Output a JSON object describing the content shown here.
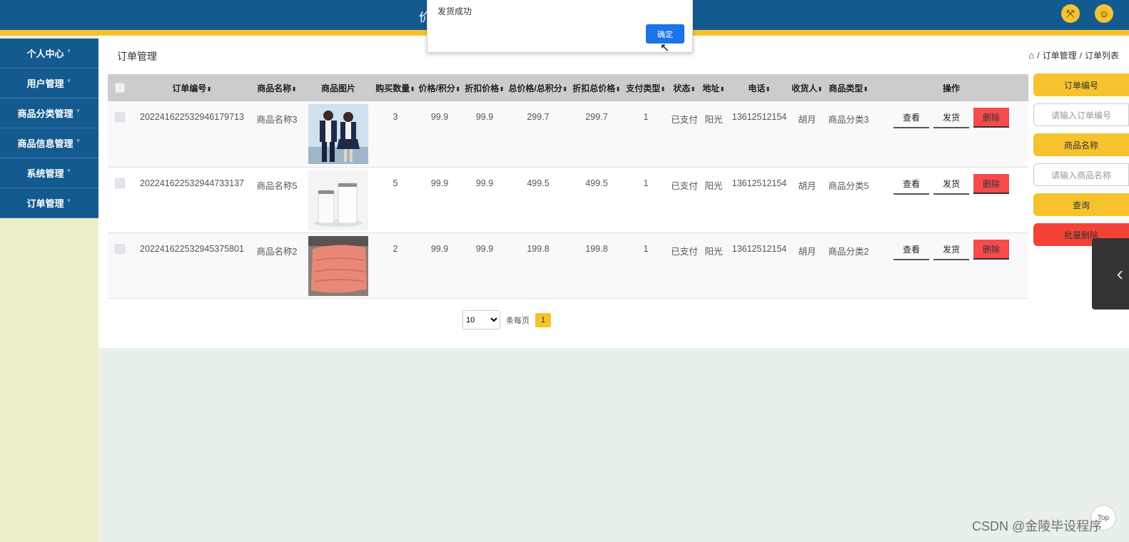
{
  "header": {
    "title_partial": "价",
    "expand_icon": "expand-arrows-icon",
    "user_icon": "user-icon"
  },
  "sidebar": {
    "items": [
      {
        "label": "个人中心"
      },
      {
        "label": "用户管理"
      },
      {
        "label": "商品分类管理"
      },
      {
        "label": "商品信息管理"
      },
      {
        "label": "系统管理"
      },
      {
        "label": "订单管理"
      }
    ]
  },
  "page": {
    "title": "订单管理",
    "breadcrumb": {
      "sep": "/",
      "level1": "订单管理",
      "level2": "订单列表"
    }
  },
  "table": {
    "headers": {
      "order_no": "订单编号",
      "product_name": "商品名称",
      "product_image": "商品图片",
      "qty": "购买数量",
      "price": "价格/积分",
      "discount_price": "折扣价格",
      "total": "总价格/总积分",
      "discount_total": "折扣总价格",
      "pay_type": "支付类型",
      "status": "状态",
      "address": "地址",
      "phone": "电话",
      "receiver": "收货人",
      "product_type": "商品类型",
      "ops": "操作"
    },
    "rows": [
      {
        "order_no": "20224162253294617971​3",
        "product_name": "商品名称3",
        "image": "school-uniform-photo",
        "qty": "3",
        "price": "99.9",
        "discount_price": "99.9",
        "total": "299.7",
        "discount_total": "299.7",
        "pay_type": "1",
        "status": "已支付",
        "address": "阳光",
        "phone": "13612512154",
        "receiver": "胡月",
        "product_type": "商品分类3"
      },
      {
        "order_no": "202241622532944733137",
        "product_name": "商品名称5",
        "image": "white-cups-photo",
        "qty": "5",
        "price": "99.9",
        "discount_price": "99.9",
        "total": "499.5",
        "discount_total": "499.5",
        "pay_type": "1",
        "status": "已支付",
        "address": "阳光",
        "phone": "13612512154",
        "receiver": "胡月",
        "product_type": "商品分类5"
      },
      {
        "order_no": "202241622532945375801",
        "product_name": "商品名称2",
        "image": "pink-quilt-photo",
        "qty": "2",
        "price": "99.9",
        "discount_price": "99.9",
        "total": "199.8",
        "discount_total": "199.8",
        "pay_type": "1",
        "status": "已支付",
        "address": "阳光",
        "phone": "13612512154",
        "receiver": "胡月",
        "product_type": "商品分类2"
      }
    ],
    "actions": {
      "view": "查看",
      "ship": "发货",
      "delete": "删除"
    }
  },
  "pagination": {
    "page_size": "10",
    "per_page_label": "条每页",
    "current_page": "1"
  },
  "search": {
    "order_no_label": "订单编号",
    "order_no_placeholder": "请输入订单编号",
    "product_name_label": "商品名称",
    "product_name_placeholder": "请输入商品名称",
    "query_button": "查询",
    "batch_delete_button": "批量删除"
  },
  "dialog": {
    "message": "发货成功",
    "ok_button": "确定"
  },
  "footer": {
    "top_button": "Top",
    "watermark": "CSDN @金陵毕设程序"
  },
  "colors": {
    "primary_blue": "#135a8f",
    "accent_yellow": "#f6c32e",
    "danger_red": "#f64b4b",
    "dialog_blue": "#1a73e8"
  }
}
